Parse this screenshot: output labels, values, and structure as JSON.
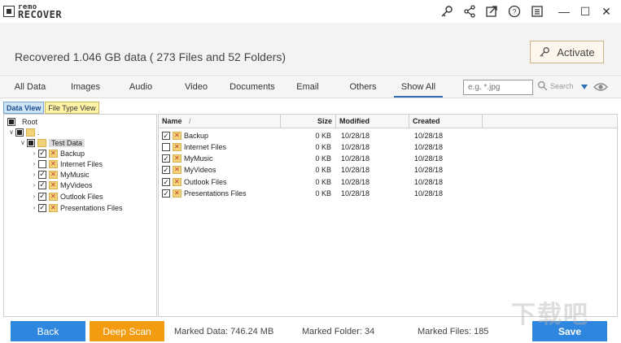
{
  "app": {
    "logo_top": "remo",
    "logo_bottom": "RECOVER"
  },
  "header": {
    "recovered_text": "Recovered 1.046    GB data ( 273 Files and 52 Folders)",
    "activate_label": "Activate"
  },
  "tabs": [
    {
      "label": "All Data"
    },
    {
      "label": "Images"
    },
    {
      "label": "Audio"
    },
    {
      "label": "Video"
    },
    {
      "label": "Documents"
    },
    {
      "label": "Email"
    },
    {
      "label": "Others"
    },
    {
      "label": "Show All",
      "active": true
    }
  ],
  "filter": {
    "placeholder": "e.g. *.jpg",
    "search_placeholder": "Search"
  },
  "view_tabs": {
    "data_view": "Data View",
    "file_type_view": "File Type View"
  },
  "tree": {
    "root": "Root",
    "drive": ".",
    "test_data": "Test Data",
    "children": [
      {
        "label": "Backup",
        "checked": true
      },
      {
        "label": "Internet Files",
        "checked": false
      },
      {
        "label": "MyMusic",
        "checked": true
      },
      {
        "label": "MyVideos",
        "checked": true
      },
      {
        "label": "Outlook Files",
        "checked": true
      },
      {
        "label": "Presentations Files",
        "checked": true
      }
    ]
  },
  "list": {
    "columns": {
      "name": "Name",
      "sort": "/",
      "size": "Size",
      "modified": "Modified",
      "created": "Created"
    },
    "rows": [
      {
        "name": "Backup",
        "checked": true,
        "size": "0 KB",
        "modified": "10/28/18",
        "created": "10/28/18"
      },
      {
        "name": "Internet Files",
        "checked": false,
        "size": "0 KB",
        "modified": "10/28/18",
        "created": "10/28/18"
      },
      {
        "name": "MyMusic",
        "checked": true,
        "size": "0 KB",
        "modified": "10/28/18",
        "created": "10/28/18"
      },
      {
        "name": "MyVideos",
        "checked": true,
        "size": "0 KB",
        "modified": "10/28/18",
        "created": "10/28/18"
      },
      {
        "name": "Outlook Files",
        "checked": true,
        "size": "0 KB",
        "modified": "10/28/18",
        "created": "10/28/18"
      },
      {
        "name": "Presentations Files",
        "checked": true,
        "size": "0 KB",
        "modified": "10/28/18",
        "created": "10/28/18"
      }
    ]
  },
  "footer": {
    "back_label": "Back",
    "deep_scan_label": "Deep Scan",
    "marked_data": "Marked Data: 746.24 MB",
    "marked_folder": "Marked Folder: 34",
    "marked_files": "Marked Files: 185",
    "save_label": "Save"
  },
  "watermark": "下载吧",
  "colors": {
    "accent_blue": "#2e86de",
    "deep_scan_orange": "#f39c12",
    "folder_yellow": "#f2d37a",
    "header_bg": "#f3f3f3"
  }
}
